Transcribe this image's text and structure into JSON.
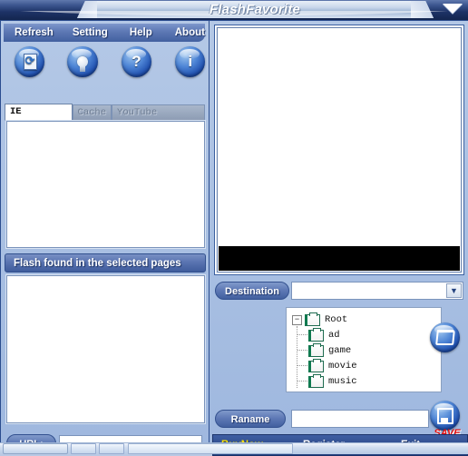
{
  "window": {
    "title": "FlashFavorite",
    "minimize_icon": "triangle-down-icon"
  },
  "menu": {
    "items": [
      {
        "label": "Refresh"
      },
      {
        "label": "Setting"
      },
      {
        "label": "Help"
      },
      {
        "label": "About"
      }
    ]
  },
  "toolbar": {
    "buttons": [
      {
        "name": "refresh-button",
        "icon": "refresh-document-icon",
        "glyph": ""
      },
      {
        "name": "setting-button",
        "icon": "lightbulb-icon",
        "glyph": ""
      },
      {
        "name": "help-button",
        "icon": "question-mark-icon",
        "glyph": "?"
      },
      {
        "name": "about-button",
        "icon": "info-icon",
        "glyph": "i"
      }
    ]
  },
  "tabs": [
    {
      "label": "IE Instance",
      "state": "active"
    },
    {
      "label": "Cache",
      "state": "disabled"
    },
    {
      "label": "YouTube Download",
      "state": "disabled"
    }
  ],
  "left_panel": {
    "ie_instance_list": {
      "items": [],
      "empty": true
    },
    "flash_section_title": "Flash found in the selected pages",
    "flash_list": {
      "items": [],
      "empty": true
    },
    "url": {
      "label": "URL:",
      "value": "",
      "placeholder": ""
    }
  },
  "right_panel": {
    "preview": {
      "content": "",
      "black_bar": true
    },
    "destination": {
      "label": "Destination",
      "value": "",
      "placeholder": "",
      "dropdown_icon": "chevron-down-icon"
    },
    "tree": {
      "root": {
        "label": "Root",
        "expander": "minus",
        "icon": "folder-icon"
      },
      "children": [
        {
          "label": "ad",
          "icon": "folder-icon"
        },
        {
          "label": "game",
          "icon": "folder-icon"
        },
        {
          "label": "movie",
          "icon": "folder-icon"
        },
        {
          "label": "music",
          "icon": "folder-icon"
        }
      ]
    },
    "browse_button": {
      "name": "browse-folder-button",
      "icon": "folder-open-icon"
    },
    "save_button": {
      "name": "save-button",
      "icon": "floppy-disk-icon",
      "caption": "SAVE"
    },
    "rename": {
      "label": "Raname",
      "value": "",
      "placeholder": ""
    }
  },
  "bottom_bar": {
    "buy_now": "BuyNow",
    "register": "Register",
    "exit": "Exit"
  },
  "colors": {
    "accent_blue": "#3f5fa3",
    "title_dark": "#14264f",
    "panel_blue": "#a8bfe2",
    "buy_now_yellow": "#ffe400",
    "save_red": "#e10f0f"
  }
}
